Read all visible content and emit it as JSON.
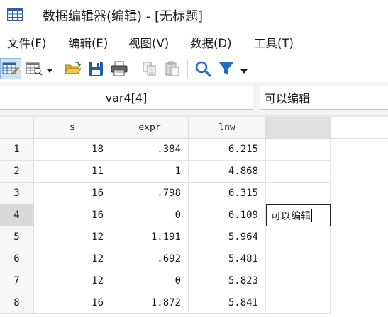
{
  "window": {
    "title": "数据编辑器(编辑) - [无标题]"
  },
  "menu": [
    {
      "label": "文件(F)"
    },
    {
      "label": "编辑(E)"
    },
    {
      "label": "视图(V)"
    },
    {
      "label": "数据(D)"
    },
    {
      "label": "工具(T)"
    }
  ],
  "toolbar": {
    "icons": [
      "data-editor-edit-icon",
      "data-editor-browse-icon",
      "open-folder-icon",
      "save-icon",
      "print-icon",
      "copy-icon",
      "paste-icon",
      "search-icon",
      "filter-icon"
    ],
    "accent": "#1f6fc9"
  },
  "edit_bar": {
    "cell_ref": "var4[4]",
    "cell_value": "可以编辑"
  },
  "grid": {
    "columns": [
      "s",
      "expr",
      "lnw",
      ""
    ],
    "rows": [
      {
        "n": "1",
        "s": "18",
        "expr": ".384",
        "lnw": "6.215",
        "var4": ""
      },
      {
        "n": "2",
        "s": "11",
        "expr": "1",
        "lnw": "4.868",
        "var4": ""
      },
      {
        "n": "3",
        "s": "16",
        "expr": ".798",
        "lnw": "6.315",
        "var4": ""
      },
      {
        "n": "4",
        "s": "16",
        "expr": "0",
        "lnw": "6.109",
        "var4": "可以编辑"
      },
      {
        "n": "5",
        "s": "12",
        "expr": "1.191",
        "lnw": "5.964",
        "var4": ""
      },
      {
        "n": "6",
        "s": "12",
        "expr": ".692",
        "lnw": "5.481",
        "var4": ""
      },
      {
        "n": "7",
        "s": "12",
        "expr": "0",
        "lnw": "5.823",
        "var4": ""
      },
      {
        "n": "8",
        "s": "16",
        "expr": "1.872",
        "lnw": "5.841",
        "var4": ""
      }
    ]
  }
}
